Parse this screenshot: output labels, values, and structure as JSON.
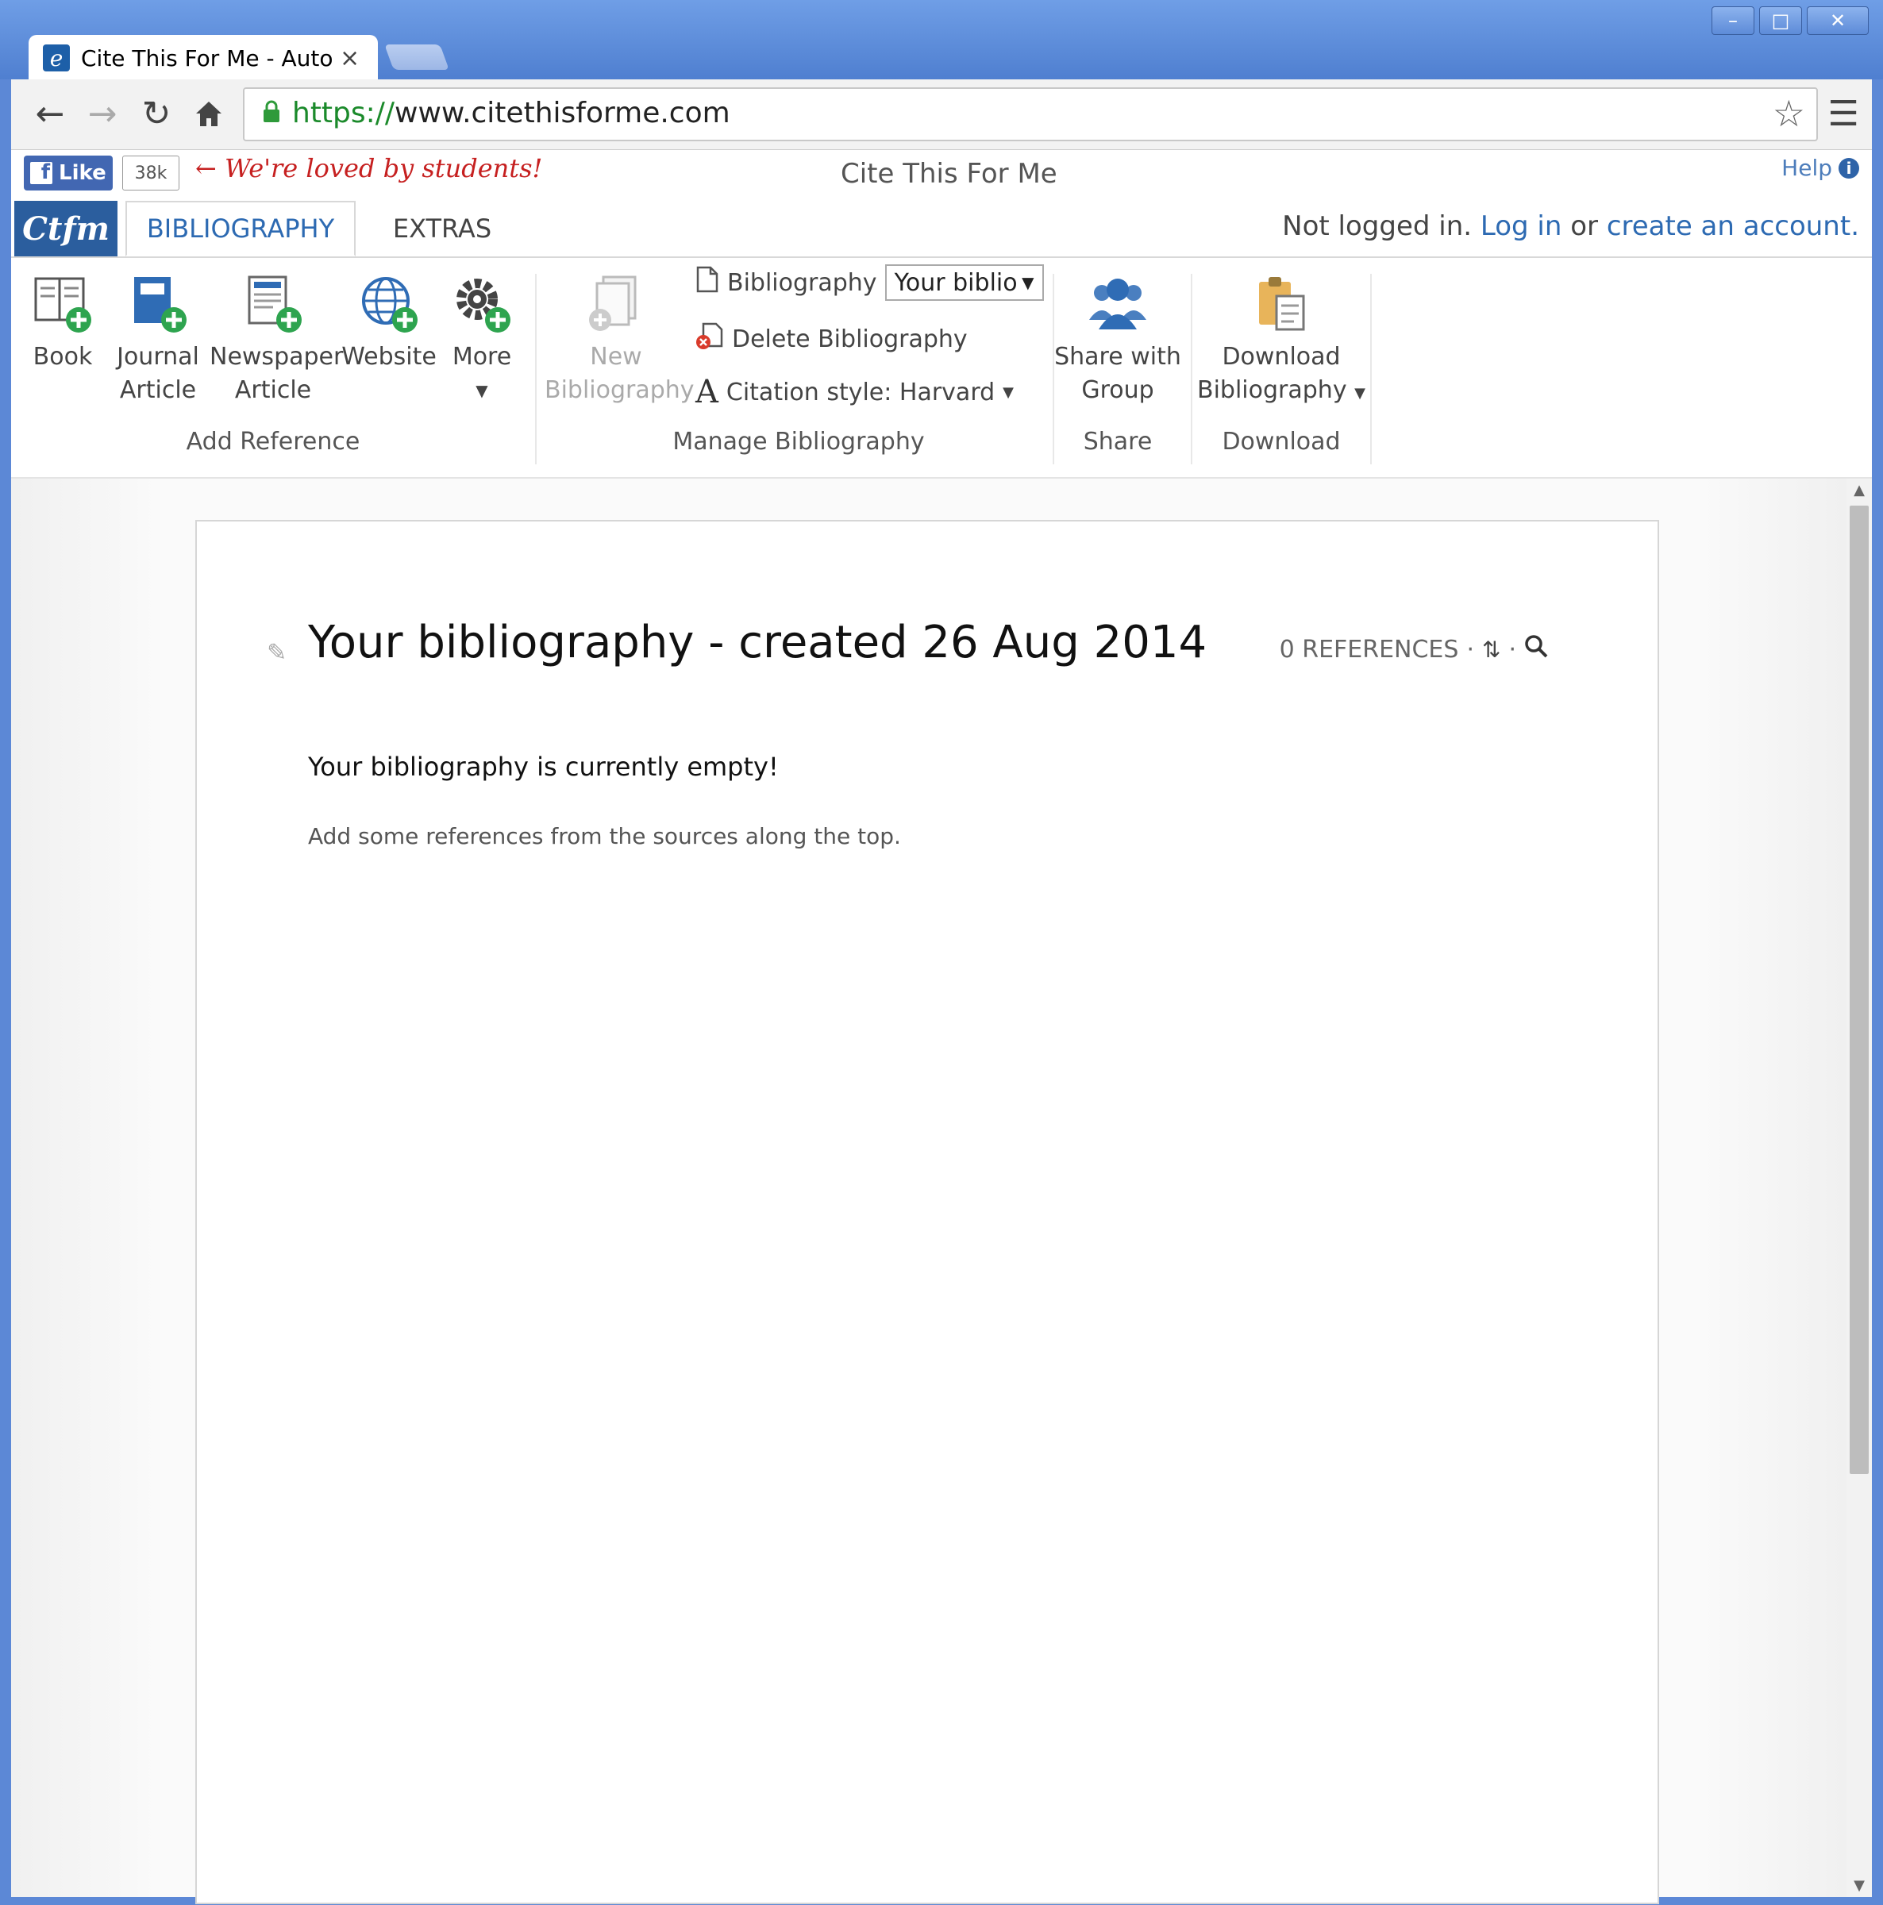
{
  "browser": {
    "tab_title": "Cite This For Me - Automä",
    "tab_close": "×",
    "url_scheme": "https://",
    "url_rest": "www.citethisforme.com",
    "window_buttons": [
      "–",
      "□",
      "✕"
    ]
  },
  "site_header": {
    "fb_like": "Like",
    "fb_count": "38k",
    "loved_text": "← We're loved by students!",
    "title": "Cite This For Me",
    "help": "Help"
  },
  "ribbon_tabs": {
    "logo": "Ctfm",
    "bibliography": "BIBLIOGRAPHY",
    "extras": "EXTRAS"
  },
  "login": {
    "prefix": "Not logged in.",
    "log_in": "Log in",
    "or": "or",
    "create": "create an account."
  },
  "add_reference": {
    "book": "Book",
    "journal_line1": "Journal",
    "journal_line2": "Article",
    "newspaper_line1": "Newspaper",
    "newspaper_line2": "Article",
    "website": "Website",
    "more": "More",
    "group_label": "Add Reference"
  },
  "manage": {
    "new_line1": "New",
    "new_line2": "Bibliography",
    "bibliography_label": "Bibliography",
    "bibliography_select": "Your biblio",
    "delete": "Delete Bibliography",
    "citation_style": "Citation style: Harvard",
    "group_label": "Manage Bibliography"
  },
  "share": {
    "line1": "Share with",
    "line2": "Group",
    "group_label": "Share"
  },
  "download": {
    "line1": "Download",
    "line2": "Bibliography",
    "group_label": "Download"
  },
  "main": {
    "title": "Your bibliography - created 26 Aug 2014",
    "references": "0 REFERENCES",
    "empty_heading": "Your bibliography is currently empty!",
    "empty_hint": "Add some references from the sources along the top."
  },
  "colors": {
    "accent": "#2d6ab2",
    "window_frame": "#5c88d6",
    "loved_red": "#c62020"
  }
}
